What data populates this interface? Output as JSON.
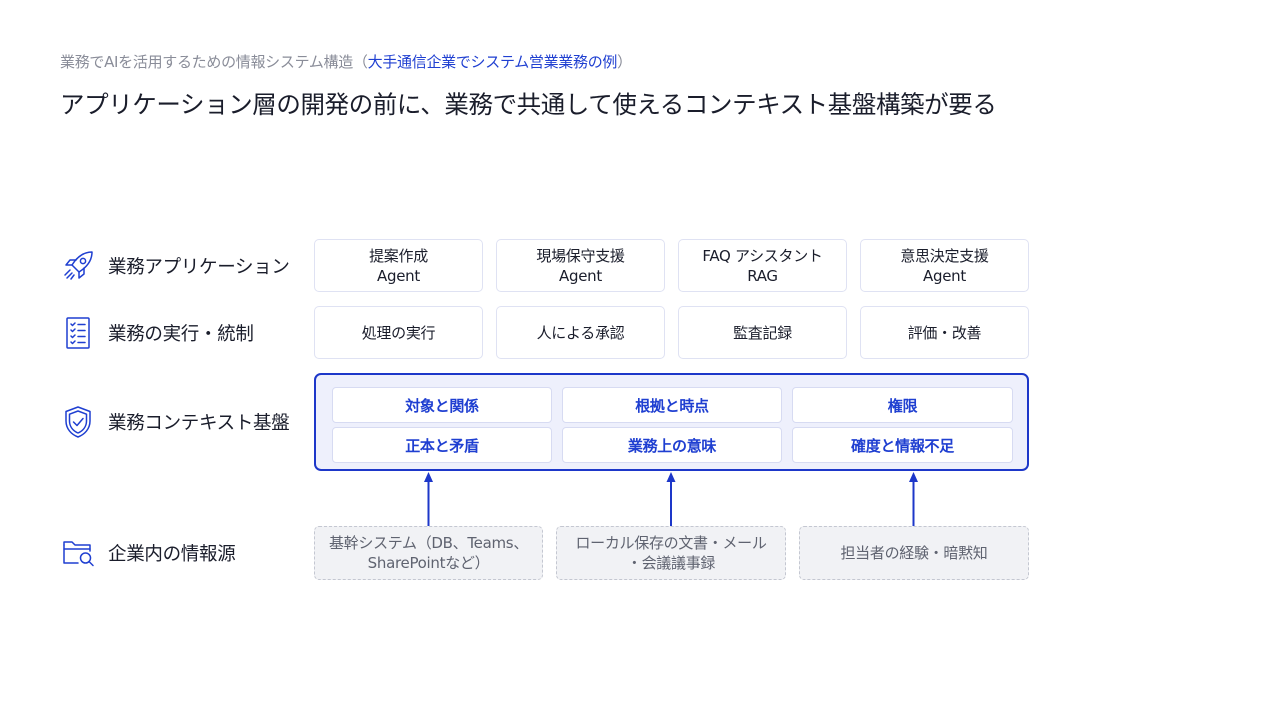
{
  "subtitle": {
    "prefix": "業務でAIを活用するための情報システム構造（",
    "accent": "大手通信企業でシステム営業業務の例",
    "suffix": "）"
  },
  "title": "アプリケーション層の開発の前に、業務で共通して使えるコンテキスト基盤構築が要る",
  "rows": {
    "apps": {
      "label": "業務アプリケーション",
      "icon": "rocket-icon",
      "cards": [
        {
          "line1": "提案作成",
          "line2": "Agent"
        },
        {
          "line1": "現場保守支援",
          "line2": "Agent"
        },
        {
          "line1": "FAQ アシスタント",
          "line2": "RAG"
        },
        {
          "line1": "意思決定支援",
          "line2": "Agent"
        }
      ]
    },
    "execution": {
      "label": "業務の実行・統制",
      "icon": "checklist-icon",
      "cards": [
        "処理の実行",
        "人による承認",
        "監査記録",
        "評価・改善"
      ]
    },
    "context": {
      "label": "業務コンテキスト基盤",
      "icon": "shield-check-icon",
      "cards": [
        "対象と関係",
        "根拠と時点",
        "権限",
        "正本と矛盾",
        "業務上の意味",
        "確度と情報不足"
      ]
    },
    "sources": {
      "label": "企業内の情報源",
      "icon": "folder-search-icon",
      "cards": [
        {
          "line1": "基幹システム（DB、Teams、",
          "line2": "SharePointなど）"
        },
        {
          "line1": "ローカル保存の文書・メール",
          "line2": "・会議議事録"
        },
        {
          "line1": "担当者の経験・暗黙知",
          "line2": ""
        }
      ]
    }
  },
  "colors": {
    "accent": "#1f3fd1",
    "border_accent": "#1d37c9",
    "context_bg": "#eef0fc",
    "source_bg": "#f1f2f5",
    "muted_text": "#8a8d99",
    "card_border": "#dfe2f3"
  }
}
